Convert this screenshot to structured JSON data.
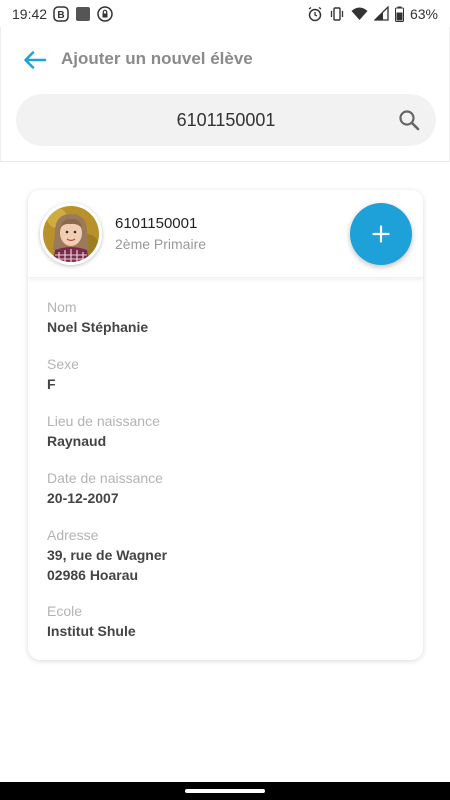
{
  "status_bar": {
    "time": "19:42",
    "battery": "63%"
  },
  "header": {
    "title": "Ajouter un nouvel élève"
  },
  "search": {
    "value": "6101150001",
    "placeholder": ""
  },
  "student": {
    "id": "6101150001",
    "class": "2ème Primaire"
  },
  "fields": {
    "nom": {
      "label": "Nom",
      "value": "Noel Stéphanie"
    },
    "sexe": {
      "label": "Sexe",
      "value": "F"
    },
    "lieu": {
      "label": "Lieu de naissance",
      "value": "Raynaud"
    },
    "date": {
      "label": "Date de naissance",
      "value": "20-12-2007"
    },
    "adresse": {
      "label": "Adresse",
      "line1": "39, rue de Wagner",
      "line2": "02986 Hoarau"
    },
    "ecole": {
      "label": "Ecole",
      "value": "Institut Shule"
    }
  },
  "colors": {
    "accent": "#1ea1d9",
    "label": "#b3b3b3",
    "value": "#444444"
  },
  "icons": {
    "back": "arrow-left-icon",
    "search": "search-icon",
    "add": "plus-icon"
  }
}
